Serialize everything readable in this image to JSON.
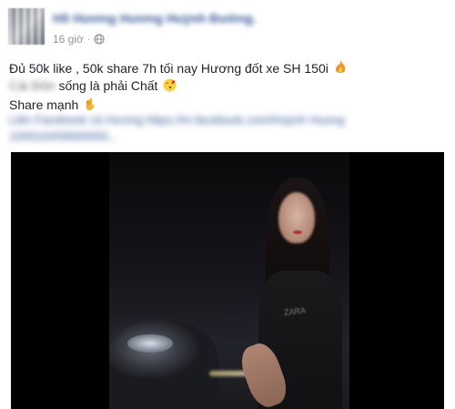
{
  "post": {
    "author_name": "Hồ Hương Hương Huỳnh Đường.",
    "time": "16 giờ",
    "separator": "·",
    "privacy_icon": "globe-icon",
    "line1": "Đủ 50k like , 50k share 7h tối nay Hương đốt xe SH 150i",
    "line1_emoji": "fire-icon",
    "line2_blurred_prefix": "Cái Đồn",
    "line2_text": " sống là phải Chất",
    "line2_emoji": "kiss-emoji-icon",
    "line3_text": "Share mạnh",
    "line3_emoji": "ok-hand-icon",
    "tag_line1": "Liên Facebook cá Hương https://m.facebook.com/Huỳnh Huong",
    "tag_line2": "100016459000000..."
  },
  "video": {
    "shirt_print": "ZARA"
  },
  "colors": {
    "link": "#365899",
    "meta": "#90949c",
    "text": "#1d2129"
  }
}
